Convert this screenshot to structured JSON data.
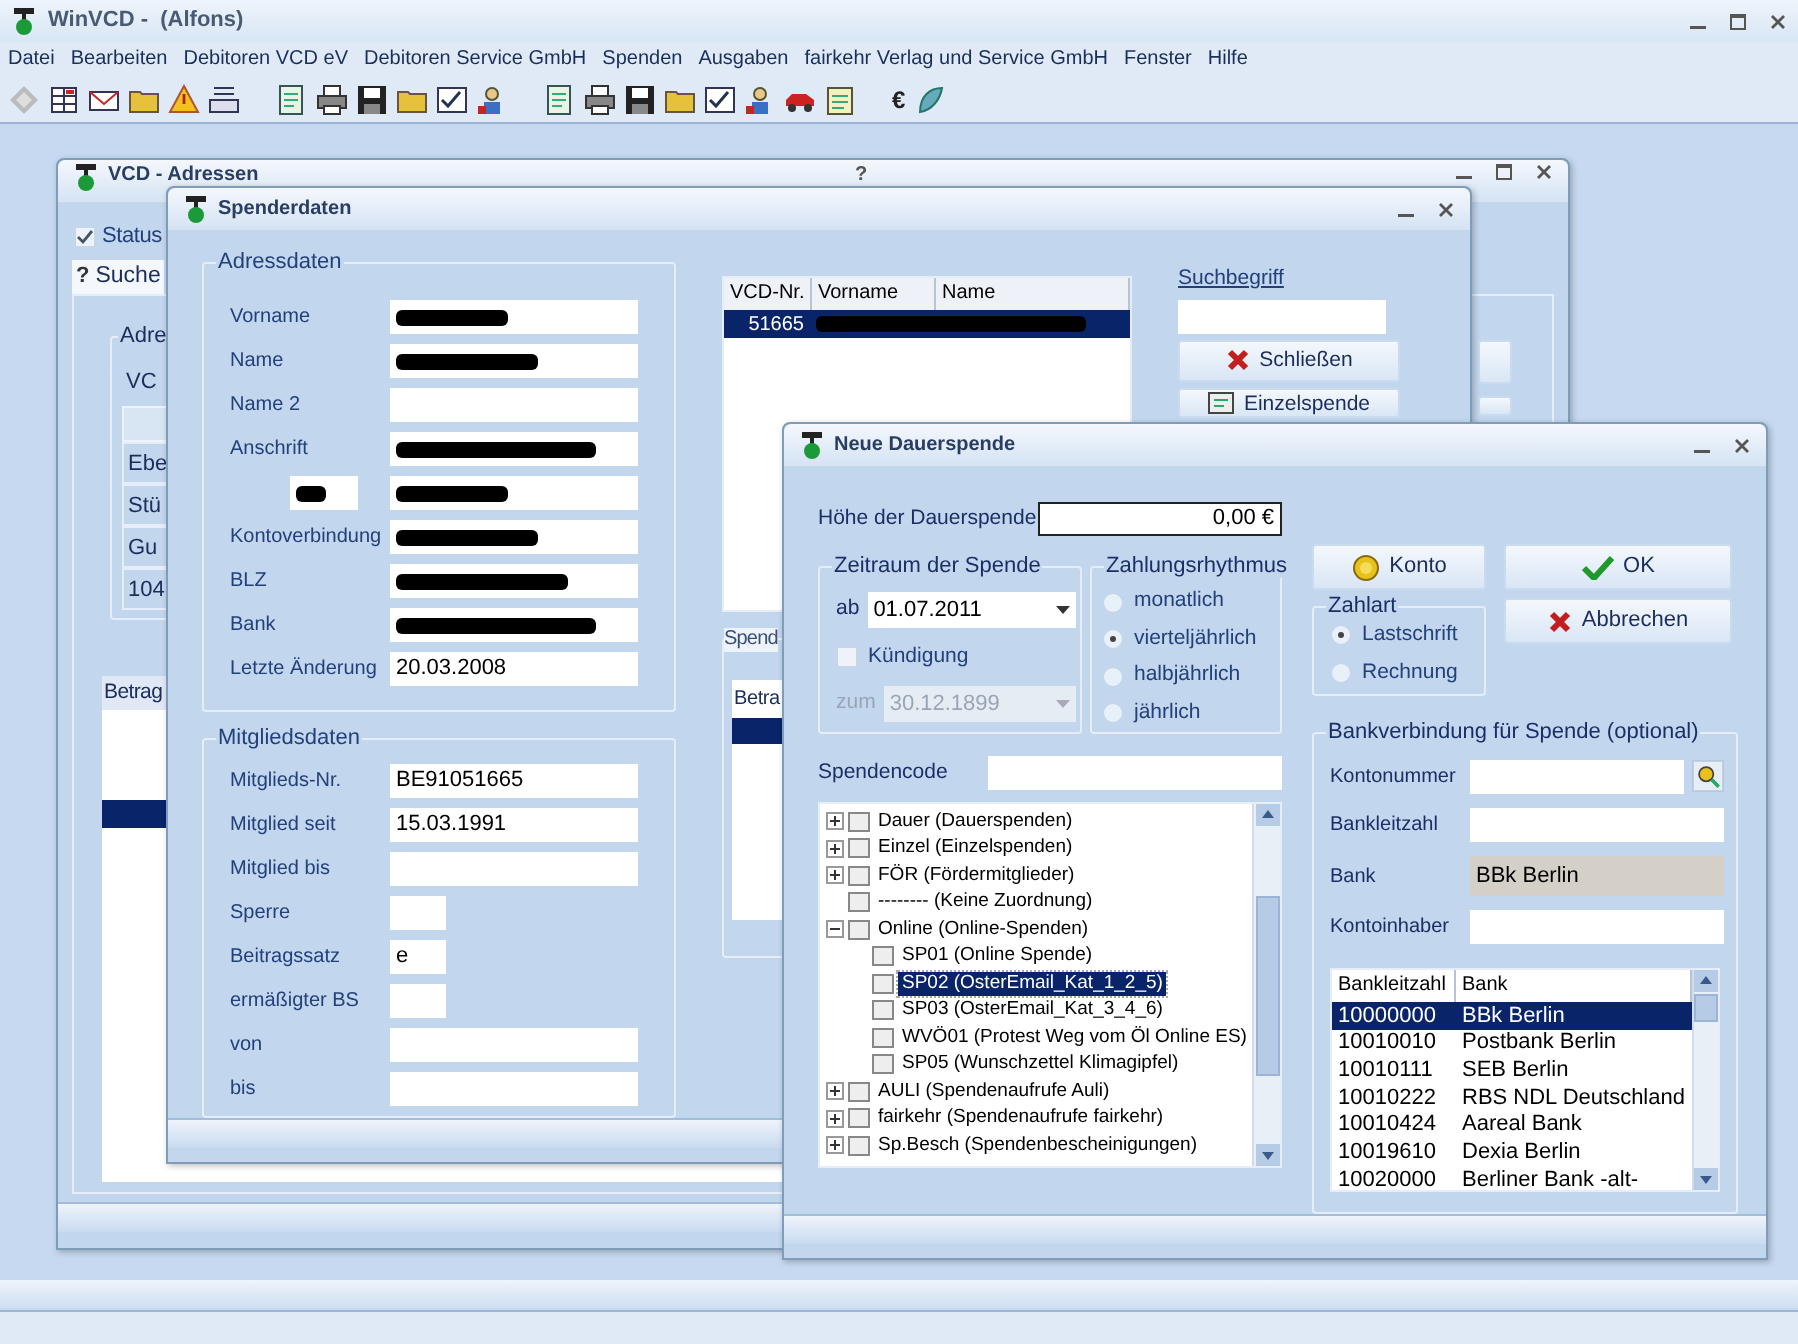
{
  "app": {
    "title": "WinVCD -  (Alfons)"
  },
  "menu": [
    "Datei",
    "Bearbeiten",
    "Debitoren VCD eV",
    "Debitoren Service GmbH",
    "Spenden",
    "Ausgaben",
    "fairkehr Verlag und Service GmbH",
    "Fenster",
    "Hilfe"
  ],
  "toolbar": {
    "currency": "€"
  },
  "adressen": {
    "title": "VCD - Adressen",
    "help": "?",
    "status": {
      "label": "Status",
      "checked": true
    },
    "tab": {
      "icon": "?",
      "label": "Suche",
      "selected": true
    },
    "group_label": "Adre",
    "column_label": "VC",
    "cells": [
      "Ebe",
      "Stü",
      "Gu",
      "104"
    ],
    "panel_label": "Betrag"
  },
  "spenderdaten": {
    "title": "Spenderdaten",
    "address_group": {
      "title": "Adressdaten",
      "fields": [
        {
          "kind": "wide",
          "label": "Vorname",
          "redacted": true
        },
        {
          "kind": "wide",
          "label": "Name",
          "redacted": true
        },
        {
          "kind": "wide",
          "label": "Name 2"
        },
        {
          "kind": "wide",
          "label": "Anschrift",
          "redacted": true
        },
        {
          "kind": "pair",
          "redacted": true
        },
        {
          "kind": "wide",
          "label": "Kontoverbindung",
          "redacted": true
        },
        {
          "kind": "wide",
          "label": "BLZ",
          "redacted": true
        },
        {
          "kind": "wide",
          "label": "Bank",
          "redacted": true
        },
        {
          "kind": "wide",
          "label": "Letzte Änderung",
          "value": "20.03.2008"
        }
      ]
    },
    "member_group": {
      "title": "Mitgliedsdaten",
      "fields": [
        {
          "kind": "wide",
          "label": "Mitglieds-Nr.",
          "value": "BE91051665"
        },
        {
          "kind": "wide",
          "label": "Mitglied seit",
          "value": "15.03.1991"
        },
        {
          "kind": "wide",
          "label": "Mitglied bis"
        },
        {
          "kind": "short",
          "label": "Sperre"
        },
        {
          "kind": "short",
          "label": "Beitragssatz",
          "value": "e"
        },
        {
          "kind": "short",
          "label": "ermäßigter BS"
        },
        {
          "kind": "wide",
          "label": "von"
        },
        {
          "kind": "wide",
          "label": "bis"
        }
      ]
    },
    "results": {
      "columns": [
        "VCD-Nr.",
        "Vorname",
        "Name"
      ],
      "rows": [
        {
          "id": "51665",
          "redacted": true,
          "selected": true
        }
      ]
    },
    "search": {
      "label": "Suchbegriff"
    },
    "buttons": [
      {
        "kind": "close",
        "label": "Schließen"
      },
      {
        "kind": "single",
        "label": "Einzelspende"
      }
    ],
    "lower": {
      "group_label": "Spend",
      "column_label": "Betra"
    }
  },
  "dauerspende": {
    "title": "Neue Dauerspende",
    "amount": {
      "label": "Höhe der Dauerspende",
      "value": "0,00 €"
    },
    "period": {
      "title": "Zeitraum der Spende",
      "from": {
        "label": "ab",
        "value": "01.07.2011",
        "disabled": false
      },
      "cancel": {
        "label": "Kündigung",
        "checked": false
      },
      "until": {
        "label": "zum",
        "value": "30.12.1899",
        "disabled": true
      }
    },
    "rhythm": {
      "title": "Zahlungsrhythmus",
      "options": [
        {
          "label": "monatlich",
          "selected": false
        },
        {
          "label": "vierteljährlich",
          "selected": true
        },
        {
          "label": "halbjährlich",
          "selected": false
        },
        {
          "label": "jährlich",
          "selected": false
        }
      ]
    },
    "code": {
      "label": "Spendencode"
    },
    "tree": [
      {
        "label": "Dauer (Dauerspenden)",
        "expanded": false,
        "selected": false
      },
      {
        "label": "Einzel (Einzelspenden)",
        "expanded": false,
        "selected": false
      },
      {
        "label": "FÖR (Fördermitglieder)",
        "expanded": false,
        "selected": false
      },
      {
        "label": "-------- (Keine Zuordnung)",
        "selected": false
      },
      {
        "label": "Online (Online-Spenden)",
        "expanded": true,
        "selected": false,
        "children": [
          {
            "label": "SP01 (Online Spende)",
            "selected": false
          },
          {
            "label": "SP02 (OsterEmail_Kat_1_2_5)",
            "selected": true
          },
          {
            "label": "SP03 (OsterEmail_Kat_3_4_6)",
            "selected": false
          },
          {
            "label": "WVÖ01 (Protest Weg vom Öl Online ES)",
            "selected": false
          },
          {
            "label": "SP05 (Wunschzettel Klimagipfel)",
            "selected": false
          }
        ]
      },
      {
        "label": "AULI (Spendenaufrufe Auli)",
        "expanded": false,
        "selected": false
      },
      {
        "label": "fairkehr (Spendenaufrufe fairkehr)",
        "expanded": false,
        "selected": false
      },
      {
        "label": "Sp.Besch (Spendenbescheinigungen)",
        "expanded": false,
        "selected": false
      }
    ],
    "buttons": [
      {
        "kind": "konto",
        "label": "Konto"
      },
      {
        "kind": "ok",
        "label": "OK"
      },
      {
        "kind": "cancel",
        "label": "Abbrechen"
      }
    ],
    "payment": {
      "title": "Zahlart",
      "options": [
        {
          "label": "Lastschrift",
          "selected": true
        },
        {
          "label": "Rechnung",
          "selected": false
        }
      ]
    },
    "bank": {
      "title": "Bankverbindung für Spende (optional)",
      "fields": [
        {
          "kind": "lookup",
          "label": "Kontonummer"
        },
        {
          "kind": "input",
          "label": "Bankleitzahl"
        },
        {
          "kind": "readonly",
          "label": "Bank",
          "value": "BBk Berlin"
        },
        {
          "kind": "input",
          "label": "Kontoinhaber"
        }
      ],
      "table": {
        "columns": [
          "Bankleitzahl",
          "Bank"
        ],
        "rows": [
          {
            "cells": [
              "10000000",
              "BBk Berlin"
            ],
            "selected": true
          },
          {
            "cells": [
              "10010010",
              "Postbank Berlin"
            ],
            "selected": false
          },
          {
            "cells": [
              "10010111",
              "SEB Berlin"
            ],
            "selected": false
          },
          {
            "cells": [
              "10010222",
              "RBS NDL Deutschland"
            ],
            "selected": false
          },
          {
            "cells": [
              "10010424",
              "Aareal Bank"
            ],
            "selected": false
          },
          {
            "cells": [
              "10019610",
              "Dexia Berlin"
            ],
            "selected": false
          },
          {
            "cells": [
              "10020000",
              "Berliner Bank -alt-"
            ],
            "selected": false
          }
        ]
      }
    }
  }
}
